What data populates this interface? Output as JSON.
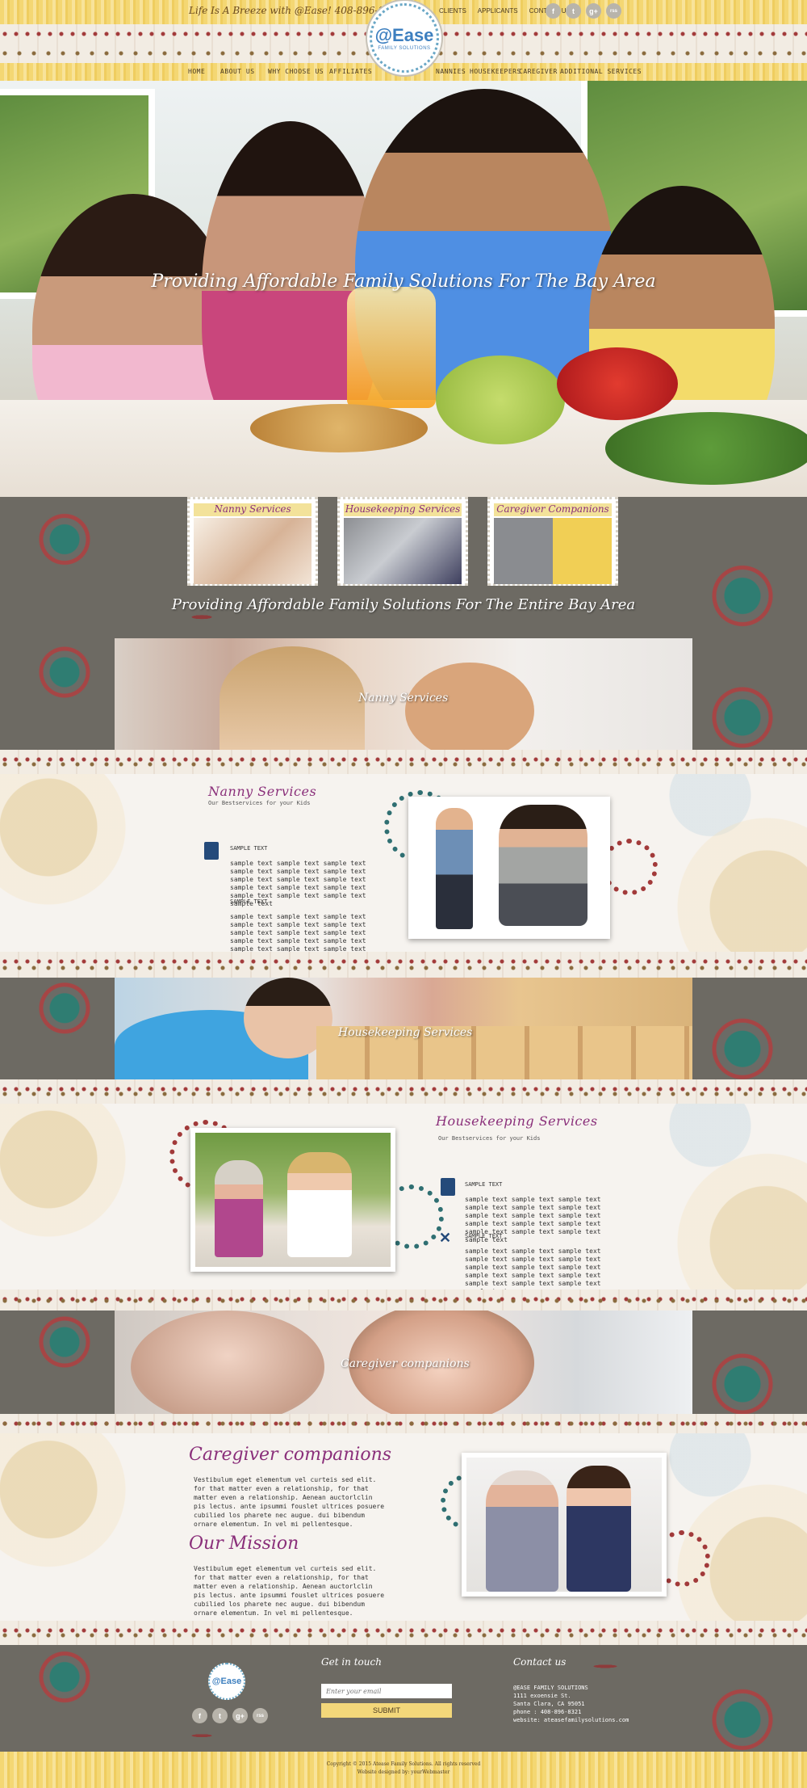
{
  "header": {
    "tagline": "Life Is A Breeze with @Ease!   408-896-8321",
    "top_links": [
      "CLIENTS",
      "APPLICANTS",
      "CONTACT US"
    ],
    "social_icons": [
      "facebook-icon",
      "twitter-icon",
      "google-plus-icon",
      "rss-icon"
    ],
    "social_glyphs": [
      "f",
      "t",
      "g+",
      "rss"
    ],
    "logo_name": "@Ease",
    "logo_sub": "FAMILY SOLUTIONS",
    "nav": [
      "HOME",
      "ABOUT US",
      "WHY CHOOSE US",
      "AFFILIATES",
      "NANNIES",
      "HOUSEKEEPERS",
      "CAREGIVER",
      "ADDITIONAL SERVICES"
    ]
  },
  "hero": {
    "title": "Providing Affordable Family Solutions For The Bay Area"
  },
  "cards": [
    {
      "title": "Nanny Services"
    },
    {
      "title": "Housekeeping Services"
    },
    {
      "title": "Caregiver Companions"
    }
  ],
  "band1": {
    "title": "Providing Affordable Family Solutions For The Entire Bay Area"
  },
  "strips": {
    "nanny": "Nanny Services",
    "housekeeping": "Housekeeping Services",
    "caregiver": "Caregiver companions"
  },
  "nanny_section": {
    "title": "Nanny Services",
    "subtitle": "Our Bestservices for your Kids",
    "features": [
      {
        "heading": "SAMPLE TEXT",
        "text": "sample text sample text sample text sample text sample text sample text sample text sample text sample text sample text sample text sample text sample text sample text sample text sample text"
      },
      {
        "heading": "SAMPLE TEXT",
        "text": "sample text sample text sample text sample text sample text sample text sample text sample text sample text sample text sample text sample text sample text sample text sample text sample text"
      }
    ]
  },
  "housekeeping_section": {
    "title": "Housekeeping Services",
    "subtitle": "Our Bestservices for your Kids",
    "features": [
      {
        "heading": "SAMPLE TEXT",
        "text": "sample text sample text sample text sample text sample text sample text sample text sample text sample text sample text sample text sample text sample text sample text sample text sample text"
      },
      {
        "heading": "SAMPLE TEXT",
        "text": "sample text sample text sample text sample text sample text sample text sample text sample text sample text sample text sample text sample text sample text sample text sample text sample text"
      }
    ]
  },
  "caregiver_section": {
    "title": "Caregiver companions",
    "text": "Vestibulum eget elementum vel curteis sed elit. for that matter even a relationship, for that matter even a relationship. Aenean auctorlclin pis lectus. ante ipsummi fouslet ultrices posuere cubilied los pharete nec augue. dui bibendum ornare elementum. In vel mi pellentesque.",
    "mission_title": "Our Mission",
    "mission_text": "Vestibulum eget elementum vel curteis sed elit. for that matter even a relationship, for that matter even a relationship. Aenean auctorlclin pis lectus. ante ipsummi fouslet ultrices posuere cubilied los pharete nec augue. dui bibendum ornare elementum. In vel mi pellentesque."
  },
  "footer": {
    "get_in_touch": "Get in touch",
    "email_placeholder": "Enter your email",
    "submit": "SUBMIT",
    "contact_title": "Contact us",
    "contact_lines": [
      "@EASE FAMILY SOLUTIONS",
      "1111 exoensie St.",
      "Santa Clara, CA 95051",
      "phone : 408-896-8321",
      "website: ateasefamilysolutions.com"
    ],
    "copyright": "Copyright © 2015 Atease Family Solutions. All rights reserved",
    "designed_by": "Website designed by: yourWebmaster"
  }
}
